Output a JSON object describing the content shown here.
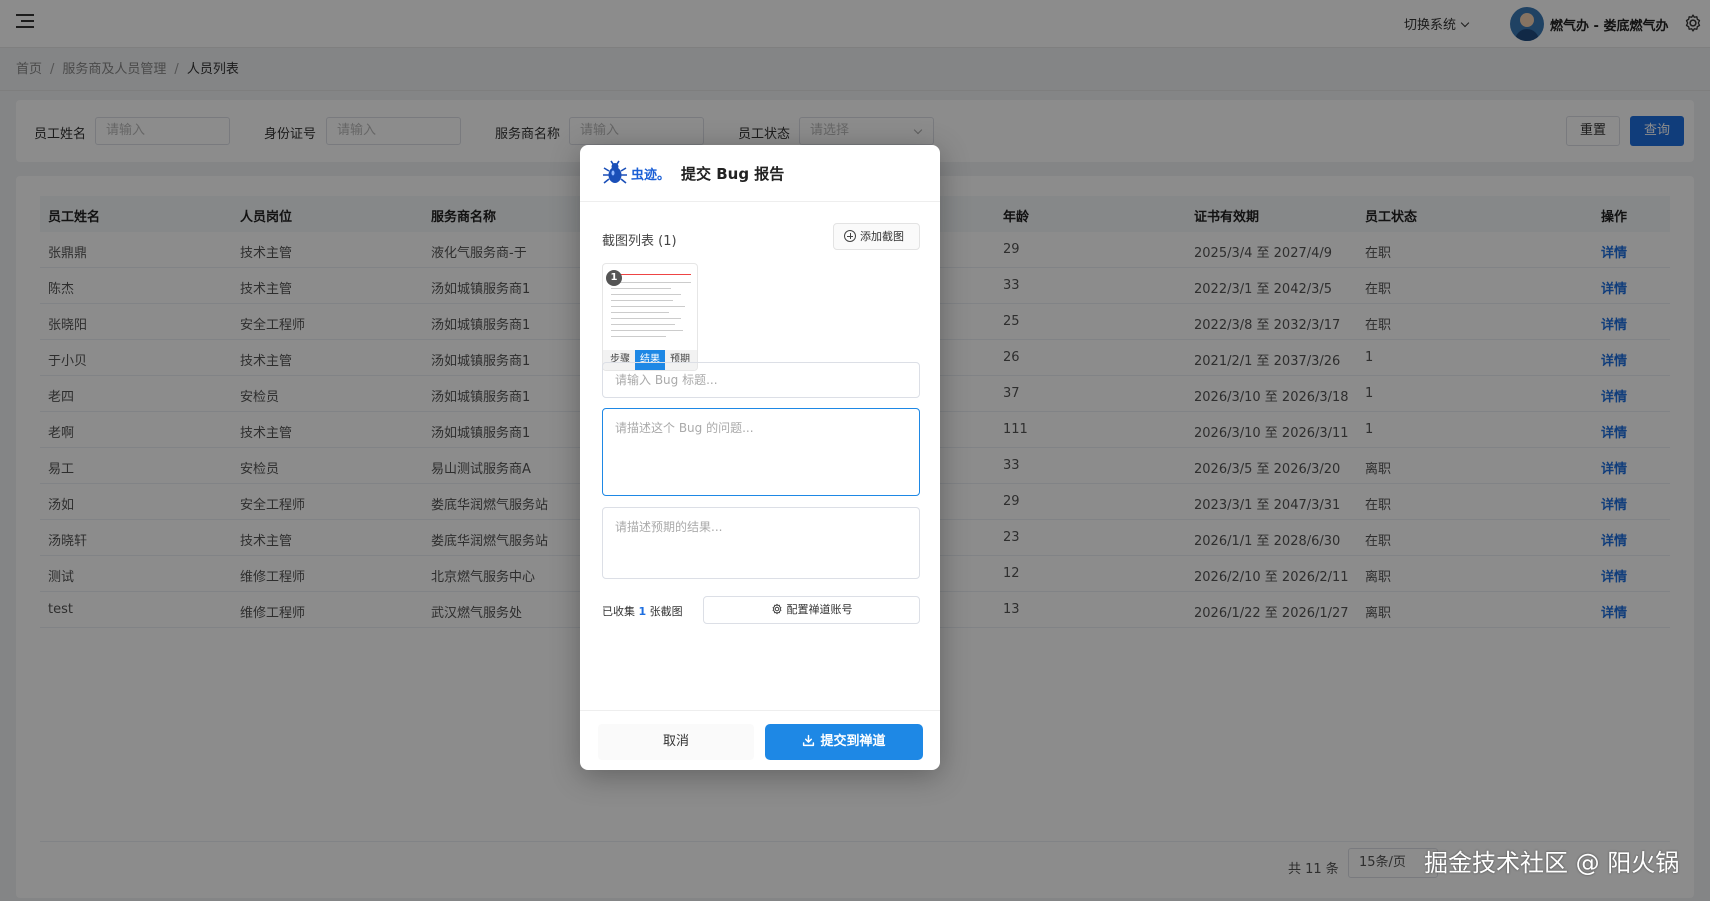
{
  "header": {
    "switch_system": "切换系统",
    "user_name": "燃气办 - 娄底燃气办"
  },
  "breadcrumb": {
    "items": [
      "首页",
      "服务商及人员管理",
      "人员列表"
    ]
  },
  "filters": {
    "employee_name_label": "员工姓名",
    "employee_name_placeholder": "请输入",
    "id_label": "身份证号",
    "id_placeholder": "请输入",
    "provider_label": "服务商名称",
    "provider_placeholder": "请输入",
    "status_label": "员工状态",
    "status_placeholder": "请选择",
    "reset_label": "重置",
    "query_label": "查询"
  },
  "table": {
    "columns": [
      "员工姓名",
      "人员岗位",
      "服务商名称",
      "年龄",
      "证书有效期",
      "员工状态",
      "操作"
    ],
    "rows": [
      [
        "张鼎鼎",
        "技术主管",
        "液化气服务商-于",
        "29",
        "2025/3/4 至 2027/4/9",
        "在职",
        "详情"
      ],
      [
        "陈杰",
        "技术主管",
        "汤如城镇服务商1",
        "33",
        "2022/3/1 至 2042/3/5",
        "在职",
        "详情"
      ],
      [
        "张晓阳",
        "安全工程师",
        "汤如城镇服务商1",
        "25",
        "2022/3/8 至 2032/3/17",
        "在职",
        "详情"
      ],
      [
        "于小贝",
        "技术主管",
        "汤如城镇服务商1",
        "26",
        "2021/2/1 至 2037/3/26",
        "1",
        "详情"
      ],
      [
        "老四",
        "安检员",
        "汤如城镇服务商1",
        "37",
        "2026/3/10 至 2026/3/18",
        "1",
        "详情"
      ],
      [
        "老啊",
        "技术主管",
        "汤如城镇服务商1",
        "111",
        "2026/3/10 至 2026/3/11",
        "1",
        "详情"
      ],
      [
        "易工",
        "安检员",
        "易山测试服务商A",
        "33",
        "2026/3/5 至 2026/3/20",
        "离职",
        "详情"
      ],
      [
        "汤如",
        "安全工程师",
        "娄底华润燃气服务站",
        "29",
        "2023/3/1 至 2047/3/31",
        "在职",
        "详情"
      ],
      [
        "汤晓轩",
        "技术主管",
        "娄底华润燃气服务站",
        "23",
        "2026/1/1 至 2028/6/30",
        "在职",
        "详情"
      ],
      [
        "测试",
        "维修工程师",
        "北京燃气服务中心",
        "12",
        "2026/2/10 至 2026/2/11",
        "离职",
        "详情"
      ],
      [
        "test",
        "维修工程师",
        "武汉燃气服务处",
        "13",
        "2026/1/22 至 2026/1/27",
        "离职",
        "详情"
      ]
    ]
  },
  "pagination": {
    "total": "共 11 条",
    "page_size": "15条/页"
  },
  "watermark": "掘金技术社区 @ 阳火锅",
  "modal": {
    "logo_text": "虫迹。",
    "title": "提交 Bug 报告",
    "screenshots_label": "截图列表 (1)",
    "add_screenshot": "添加截图",
    "thumb_number": "1",
    "thumb_tabs": [
      "步骤",
      "结果",
      "预期"
    ],
    "bug_title_placeholder": "请输入 Bug 标题...",
    "bug_desc_placeholder": "请描述这个 Bug 的问题...",
    "expected_placeholder": "请描述预期的结果...",
    "collected_prefix": "已收集",
    "collected_count": "1",
    "collected_suffix": "张截图",
    "config_account": "配置禅道账号",
    "cancel": "取消",
    "submit": "提交到禅道"
  },
  "colors": {
    "primary": "#1e88e5",
    "link": "#1e6fe0"
  }
}
